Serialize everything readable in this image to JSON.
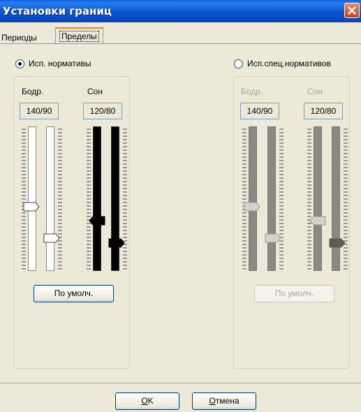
{
  "window": {
    "title": "Установки границ"
  },
  "tabs": {
    "periods": "Периоды",
    "limits": "Пределы"
  },
  "left": {
    "radio_label": "Исп. нормативы",
    "selected": true,
    "wake_label": "Бодр.",
    "sleep_label": "Сон",
    "wake_value": "140/90",
    "sleep_value": "120/80",
    "default_button": "По умолч."
  },
  "right": {
    "radio_label": "Исп.спец.нормативов",
    "selected": false,
    "wake_label": "Бодр.",
    "sleep_label": "Сон",
    "wake_value": "140/90",
    "sleep_value": "120/80",
    "default_button": "По умолч."
  },
  "footer": {
    "ok_hotkey": "O",
    "ok_rest": "K",
    "cancel_hotkey": "О",
    "cancel_rest": "тмена"
  },
  "colors": {
    "title_bar": "#0b56d0",
    "close_button": "#c8441d",
    "tab_highlight": "#e68b2c",
    "dialog_bg": "#ece9d8",
    "track_black": "#000000",
    "track_gray": "#8a8a84"
  },
  "icons": {
    "close": "close-icon",
    "radio": "radio-icon",
    "thumb": "slider-thumb-icon"
  }
}
